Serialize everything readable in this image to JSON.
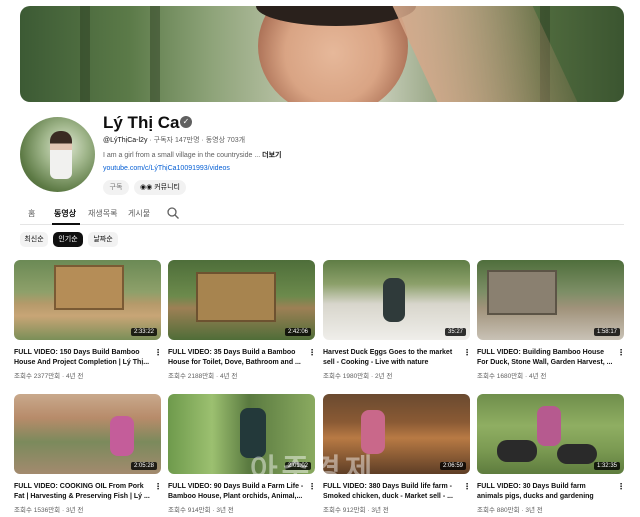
{
  "channel": {
    "name": "Lý Thị Ca",
    "handle": "@LýThịCa-l2y",
    "stats": "· 구독자 147만명 · 동영상 703개",
    "description": "I am a girl from a small village in the countryside ...",
    "more_label": "더보기",
    "link": "youtube.com/c/LýThịCa10091993/videos",
    "subscribe_label": "구독",
    "community_label": "커뮤니티"
  },
  "tabs": [
    "홈",
    "동영상",
    "재생목록",
    "게시물"
  ],
  "active_tab": "동영상",
  "chips": [
    "최신순",
    "인기순",
    "날짜순"
  ],
  "active_chip": "인기순",
  "videos": [
    {
      "title": "FULL VIDEO: 150 Days Build Bamboo House And Project Completion | Lý Thị...",
      "meta": "조회수 2377만회 · 4년 전",
      "duration": "2:33:22"
    },
    {
      "title": "FULL VIDEO: 35 Days Build a Bamboo House for Toilet, Dove, Bathroom and ...",
      "meta": "조회수 2188만회 · 4년 전",
      "duration": "2:42:06"
    },
    {
      "title": "Harvest Duck Eggs Goes to the market sell - Cooking - Live with nature",
      "meta": "조회수 1980만회 · 2년 전",
      "duration": "35:27"
    },
    {
      "title": "FULL VIDEO: Building Bamboo House For Duck, Stone Wall, Garden Harvest, ...",
      "meta": "조회수 1680만회 · 4년 전",
      "duration": "1:58:17"
    },
    {
      "title": "FULL VIDEO: COOKING OIL From Pork Fat | Harvesting & Preserving Fish | Lý ...",
      "meta": "조회수 1536만회 · 3년 전",
      "duration": "2:05:28"
    },
    {
      "title": "FULL VIDEO: 90 Days Build a Farm Life - Bamboo House, Plant orchids, Animal,...",
      "meta": "조회수 914만회 · 3년 전",
      "duration": "2:01:02"
    },
    {
      "title": "FULL VIDEO: 380 Days Build life farm - Smoked chicken, duck - Market sell - ...",
      "meta": "조회수 912만회 · 3년 전",
      "duration": "2:06:59"
    },
    {
      "title": "FULL VIDEO: 30 Days Build farm animals pigs, ducks and gardening",
      "meta": "조회수 880만회 · 3년 전",
      "duration": "1:32:35"
    }
  ],
  "watermark": "아주경제",
  "icons": {
    "verified": "verified-check-icon",
    "community": "community-icon",
    "search": "search-icon",
    "more": "more-vert-icon"
  }
}
